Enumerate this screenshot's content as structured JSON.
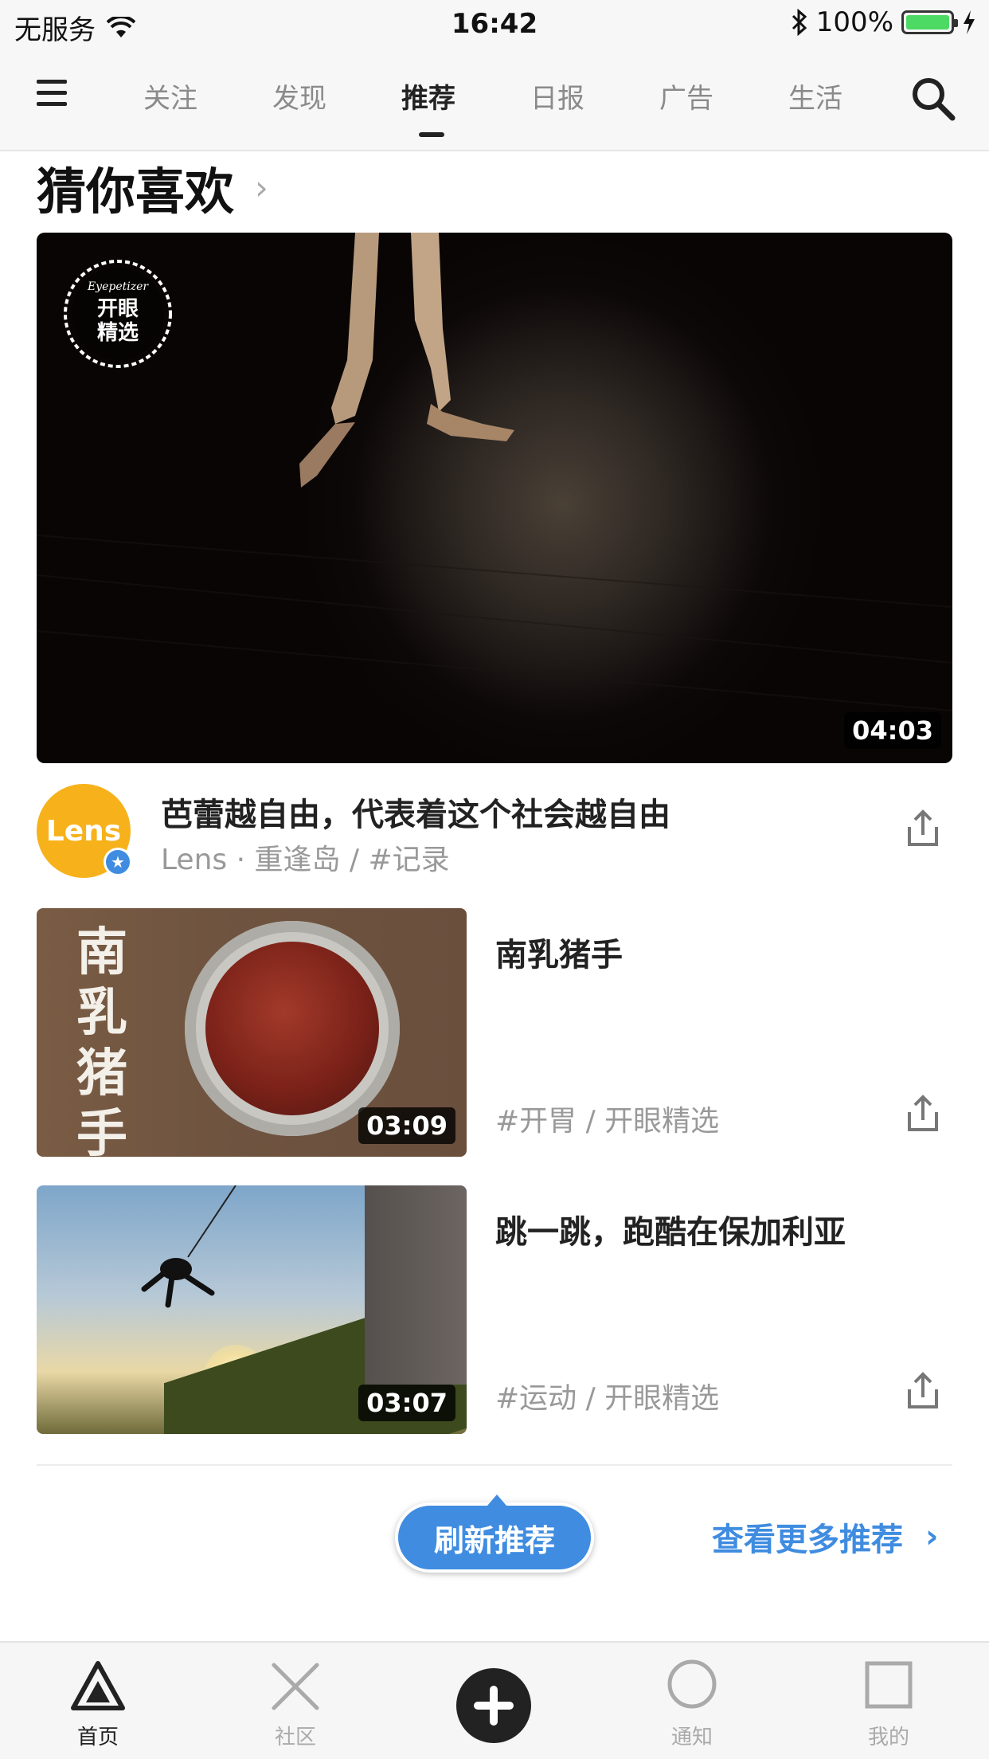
{
  "status_bar": {
    "carrier": "无服务",
    "time": "16:42",
    "battery": "100%",
    "battery_color": "#4cd964"
  },
  "top_nav": {
    "tabs": [
      {
        "label": "关注"
      },
      {
        "label": "发现"
      },
      {
        "label": "推荐",
        "active": true
      },
      {
        "label": "日报"
      },
      {
        "label": "广告"
      },
      {
        "label": "生活"
      }
    ],
    "menu_icon": "hamburger-icon",
    "search_icon": "search-icon"
  },
  "section": {
    "title": "猜你喜欢",
    "chevron": "›"
  },
  "hero": {
    "duration": "04:03",
    "badge_lines": [
      "开眼",
      "精选"
    ],
    "badge_brand": "Eyepetizer"
  },
  "author_row": {
    "avatar_text": "Lens",
    "title": "芭蕾越自由，代表着这个社会越自由",
    "meta": "Lens · 重逢岛  /  #记录"
  },
  "items": [
    {
      "title": "南乳猪手",
      "tags": "#开胃  /  开眼精选",
      "duration": "03:09",
      "thumb_text": "南乳猪手"
    },
    {
      "title": "跳一跳，跑酷在保加利亚",
      "tags": "#运动  /  开眼精选",
      "duration": "03:07"
    }
  ],
  "refresh": {
    "button_label": "刷新推荐",
    "more_label": "查看更多推荐",
    "more_chevron": "›",
    "accent_color": "#3f8ce0"
  },
  "tab_bar": {
    "items": [
      {
        "label": "首页",
        "icon": "triangle-icon",
        "active": true
      },
      {
        "label": "社区",
        "icon": "x-icon"
      },
      {
        "label": "",
        "icon": "plus-icon"
      },
      {
        "label": "通知",
        "icon": "circle-icon"
      },
      {
        "label": "我的",
        "icon": "square-icon"
      }
    ]
  }
}
